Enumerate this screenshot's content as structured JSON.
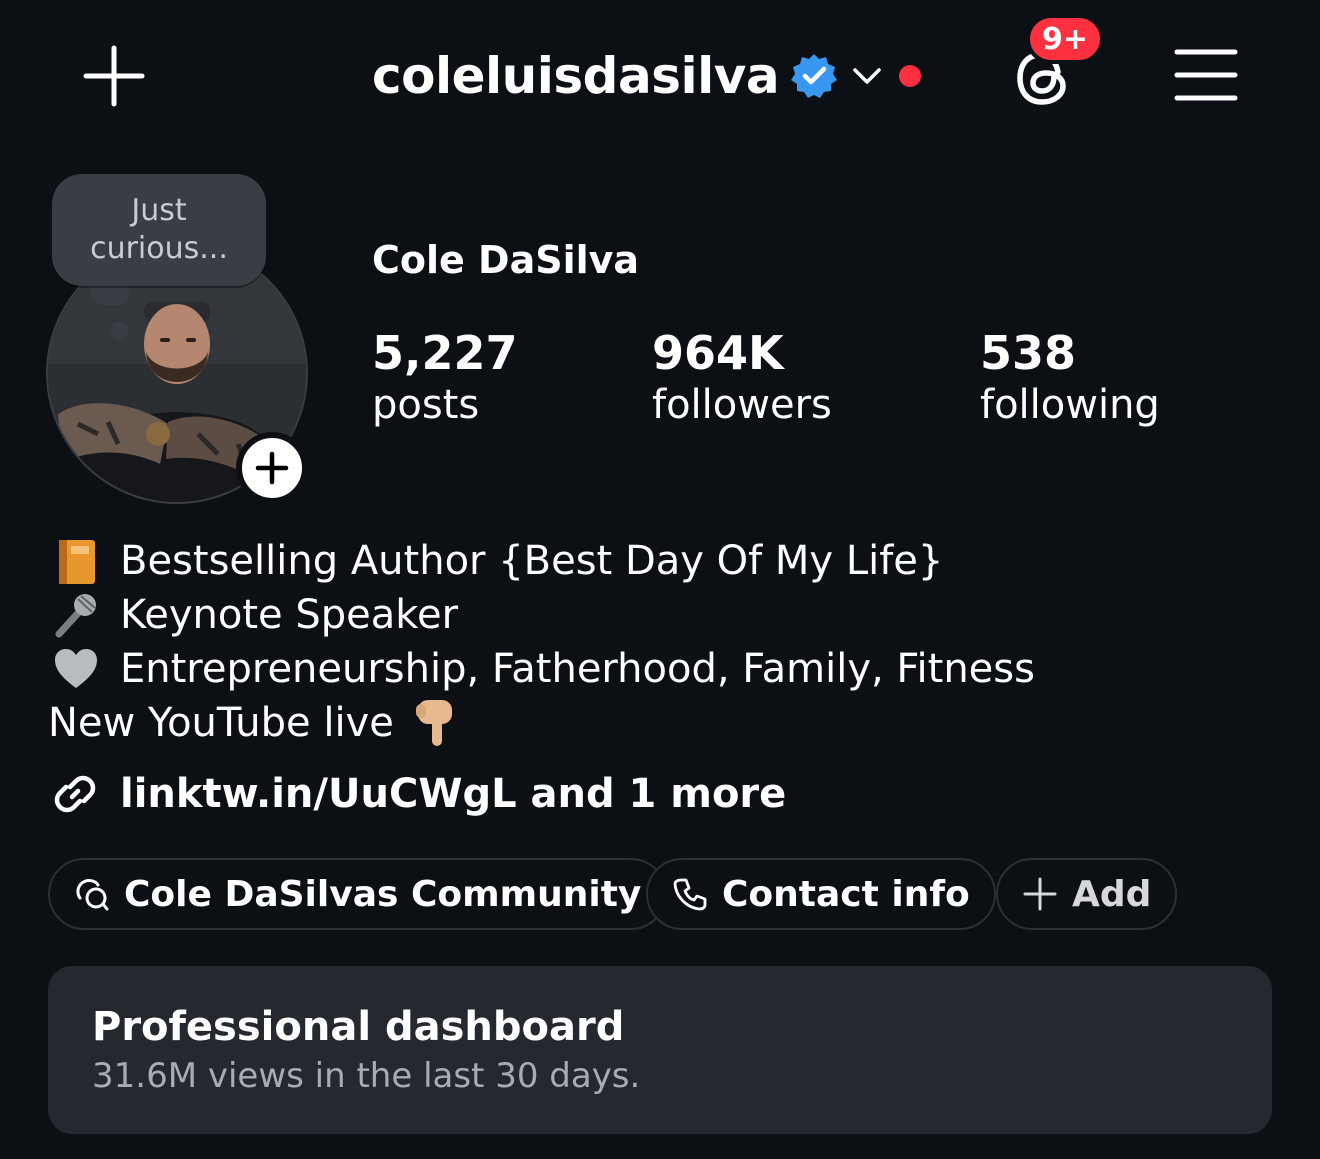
{
  "header": {
    "username": "coleluisdasilva",
    "notification_badge": "9+",
    "icons": [
      "plus-icon",
      "verified-badge-icon",
      "chevron-down-icon",
      "threads-icon",
      "hamburger-menu-icon"
    ],
    "accent_colors": {
      "verified": "#3897f0",
      "alert": "#ff3040"
    }
  },
  "profile": {
    "note": "Just curious...",
    "display_name": "Cole DaSilva",
    "stats": [
      {
        "value": "5,227",
        "label": "posts"
      },
      {
        "value": "964K",
        "label": "followers"
      },
      {
        "value": "538",
        "label": "following"
      }
    ]
  },
  "bio": {
    "lines": [
      {
        "emoji": "book",
        "text": "Bestselling Author {Best Day Of My Life}"
      },
      {
        "emoji": "microphone",
        "text": "Keynote Speaker"
      },
      {
        "emoji": "grey-heart",
        "text": "Entrepreneurship, Fatherhood, Family, Fitness"
      },
      {
        "emoji": "pointing-down-hand",
        "text": "New YouTube live"
      }
    ],
    "link": "linktw.in/UuCWgL and 1 more"
  },
  "chips": [
    {
      "icon": "community-chat-icon",
      "label": "Cole DaSilvas Community"
    },
    {
      "icon": "phone-icon",
      "label": "Contact info"
    },
    {
      "icon": "plus-icon",
      "label": "Add"
    }
  ],
  "dashboard": {
    "title": "Professional dashboard",
    "subtitle": "31.6M views in the last 30 days."
  }
}
